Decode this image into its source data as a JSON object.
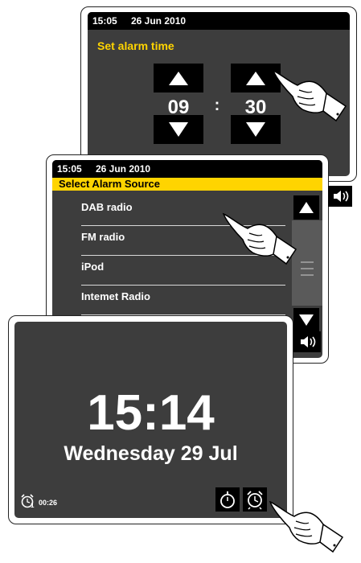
{
  "alarm_time_screen": {
    "status": {
      "time": "15:05",
      "date": "26 Jun 2010"
    },
    "title": "Set alarm time",
    "hours": "09",
    "separator": ":",
    "minutes": "30"
  },
  "alarm_source_screen": {
    "status": {
      "time": "15:05",
      "date": "26 Jun 2010"
    },
    "title": "Select Alarm Source",
    "items": [
      {
        "label": "DAB radio"
      },
      {
        "label": "FM radio"
      },
      {
        "label": "iPod"
      },
      {
        "label": "Intemet Radio"
      }
    ]
  },
  "clock_screen": {
    "time": "15:14",
    "date": "Wednesday 29 Jul",
    "alarm_indicator": {
      "number": "1",
      "time": "00:26"
    }
  },
  "colors": {
    "accent": "#ffd400",
    "screen_bg": "#3d3d3d",
    "button_bg": "#000000"
  },
  "icons": [
    "arrow-up-icon",
    "arrow-down-icon",
    "volume-icon",
    "timer-icon",
    "alarm-clock-icon",
    "pointing-hand-icon"
  ]
}
